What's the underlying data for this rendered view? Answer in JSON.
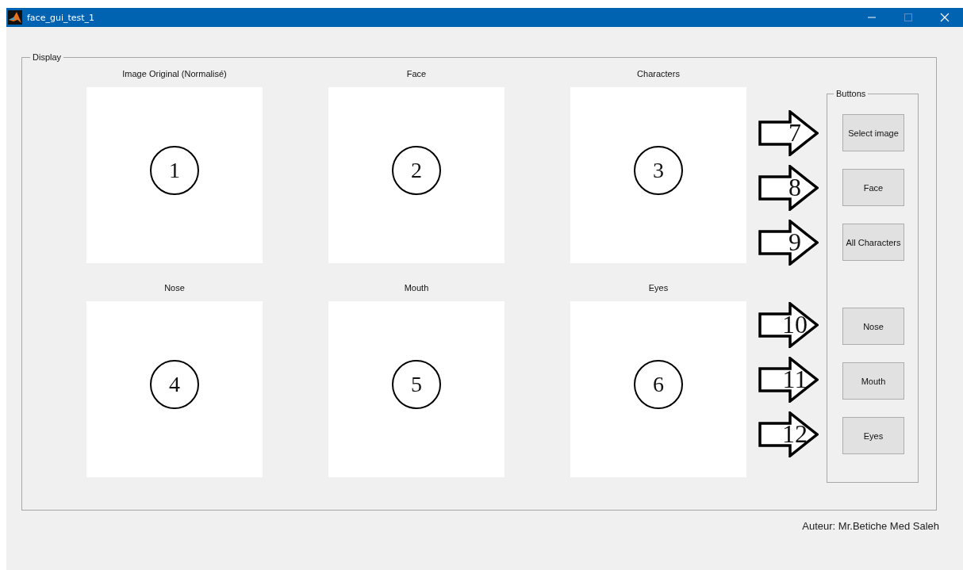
{
  "window": {
    "title": "face_gui_test_1"
  },
  "display": {
    "title": "Display",
    "axes": [
      {
        "title": "Image Original (Normalisé)",
        "marker": "1"
      },
      {
        "title": "Face",
        "marker": "2"
      },
      {
        "title": "Characters",
        "marker": "3"
      },
      {
        "title": "Nose",
        "marker": "4"
      },
      {
        "title": "Mouth",
        "marker": "5"
      },
      {
        "title": "Eyes",
        "marker": "6"
      }
    ]
  },
  "buttons_panel": {
    "title": "Buttons",
    "button_groups": [
      [
        {
          "label": "Select image",
          "callout": "7"
        },
        {
          "label": "Face",
          "callout": "8"
        },
        {
          "label": "All Characters",
          "callout": "9"
        }
      ],
      [
        {
          "label": "Nose",
          "callout": "10"
        },
        {
          "label": "Mouth",
          "callout": "11"
        },
        {
          "label": "Eyes",
          "callout": "12"
        }
      ]
    ]
  },
  "author": "Auteur: Mr.Betiche Med Saleh"
}
